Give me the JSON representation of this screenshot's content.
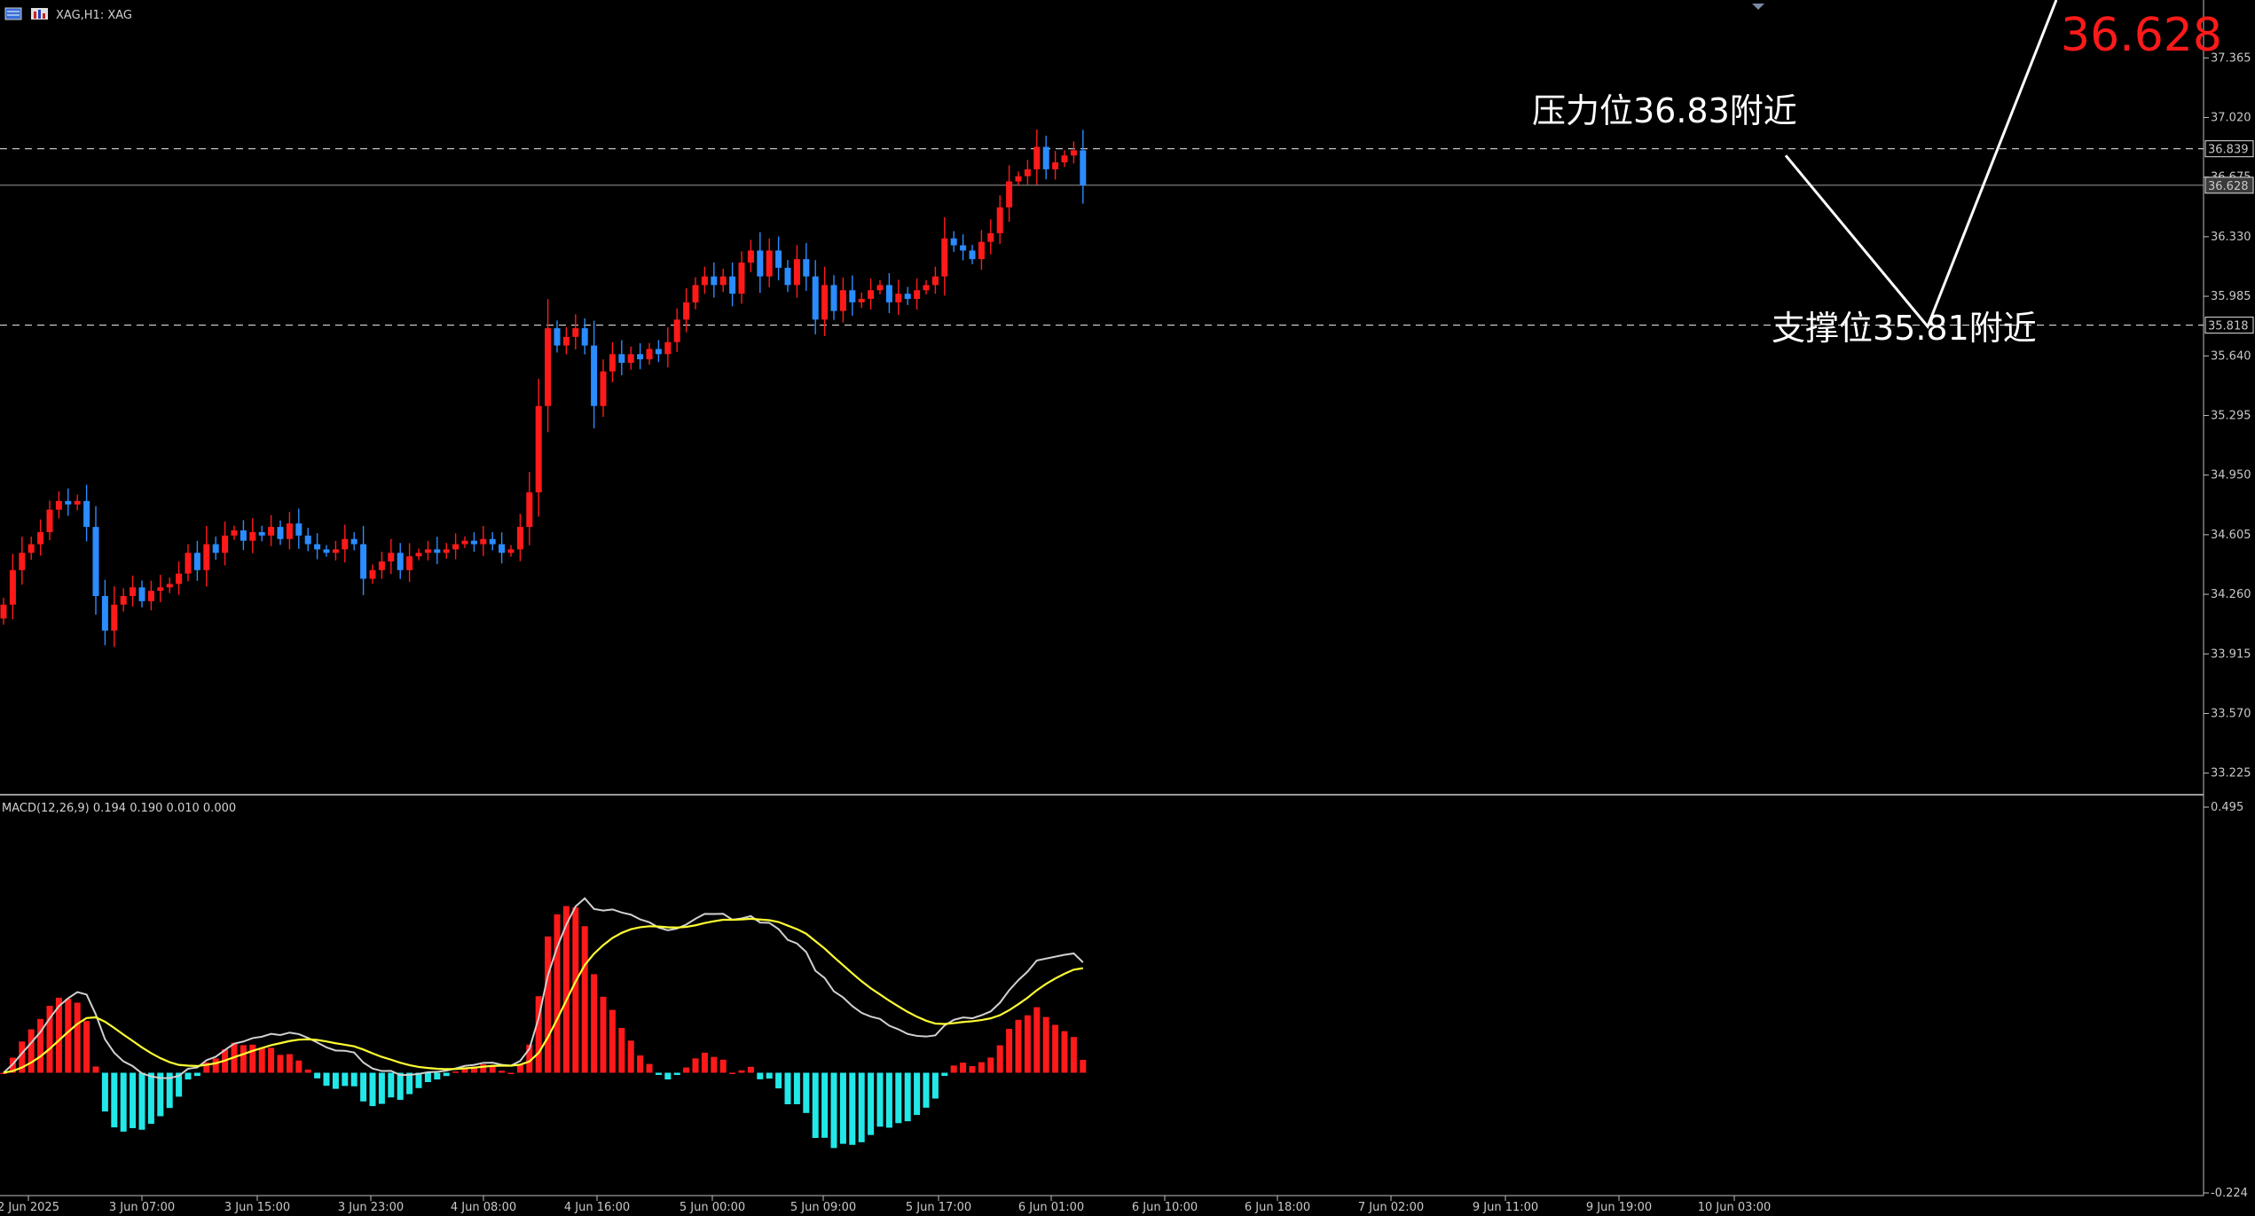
{
  "window": {
    "title": "XAG,H1: XAG",
    "toolbar_icons": [
      "chart-menu-icon",
      "one-click-trading-icon"
    ]
  },
  "colors": {
    "background": "#000000",
    "bull": "#ff1a1a",
    "bear": "#2a8cff",
    "macd_pos": "#ff1a1a",
    "macd_neg": "#22e8e8",
    "macd_line": "#d0d0d0",
    "signal_line": "#ffff33",
    "grid": "#ffffff",
    "axis": "#c0c0c0"
  },
  "chart_data": [
    {
      "type": "candlestick",
      "title": "XAG,H1: XAG",
      "ylim": [
        33.1,
        37.7
      ],
      "y_ticks": [
        "37.365",
        "37.020",
        "36.675",
        "36.330",
        "35.985",
        "35.640",
        "35.295",
        "34.950",
        "34.605",
        "34.260",
        "33.915",
        "33.570",
        "33.225"
      ],
      "price_markers": [
        {
          "label": "36.839",
          "value": 36.839,
          "style": "dashed"
        },
        {
          "label": "36.628",
          "value": 36.628,
          "style": "solid"
        },
        {
          "label": "35.818",
          "value": 35.818,
          "style": "dashed"
        }
      ],
      "annotations": [
        {
          "text": "压力位36.83附近"
        },
        {
          "text": "支撑位35.81附近"
        },
        {
          "text": "36.628"
        }
      ],
      "projection": [
        36.8,
        35.81,
        37.7
      ],
      "closes": [
        34.2,
        34.4,
        34.5,
        34.55,
        34.62,
        34.75,
        34.8,
        34.78,
        34.8,
        34.65,
        34.25,
        34.05,
        34.2,
        34.25,
        34.3,
        34.22,
        34.28,
        34.3,
        34.32,
        34.38,
        34.5,
        34.4,
        34.55,
        34.5,
        34.6,
        34.63,
        34.57,
        34.62,
        34.6,
        34.65,
        34.58,
        34.67,
        34.6,
        34.55,
        34.52,
        34.5,
        34.52,
        34.58,
        34.55,
        34.35,
        34.4,
        34.45,
        34.5,
        34.4,
        34.48,
        34.5,
        34.52,
        34.5,
        34.52,
        34.55,
        34.57,
        34.55,
        34.58,
        34.55,
        34.5,
        34.52,
        34.65,
        34.85,
        35.35,
        35.8,
        35.7,
        35.75,
        35.8,
        35.7,
        35.35,
        35.55,
        35.65,
        35.6,
        35.65,
        35.62,
        35.68,
        35.65,
        35.72,
        35.85,
        35.95,
        36.05,
        36.1,
        36.05,
        36.1,
        36.0,
        36.18,
        36.25,
        36.1,
        36.25,
        36.15,
        36.05,
        36.2,
        36.1,
        35.85,
        36.05,
        35.9,
        36.02,
        35.95,
        35.97,
        36.02,
        36.05,
        35.95,
        36.0,
        35.97,
        36.02,
        36.05,
        36.1,
        36.32,
        36.28,
        36.25,
        36.2,
        36.3,
        36.35,
        36.5,
        36.65,
        36.68,
        36.72,
        36.85,
        36.72,
        36.76,
        36.8,
        36.83,
        36.628
      ]
    },
    {
      "type": "histogram",
      "title": "MACD(12,26,9) 0.194 0.190 0.010 0.000",
      "ylim": [
        -0.224,
        0.495
      ],
      "y_ticks": [
        "0.495",
        "-0.224"
      ],
      "x_ticks": [
        "2 Jun 2025",
        "3 Jun 07:00",
        "3 Jun 15:00",
        "3 Jun 23:00",
        "4 Jun 08:00",
        "4 Jun 16:00",
        "5 Jun 00:00",
        "5 Jun 09:00",
        "5 Jun 17:00",
        "6 Jun 01:00",
        "6 Jun 10:00",
        "6 Jun 18:00",
        "7 Jun 02:00",
        "9 Jun 11:00",
        "9 Jun 19:00",
        "10 Jun 03:00"
      ],
      "series": [
        {
          "name": "MACD",
          "role": "line"
        },
        {
          "name": "Signal",
          "role": "line"
        },
        {
          "name": "Histogram",
          "role": "bars"
        }
      ]
    }
  ]
}
